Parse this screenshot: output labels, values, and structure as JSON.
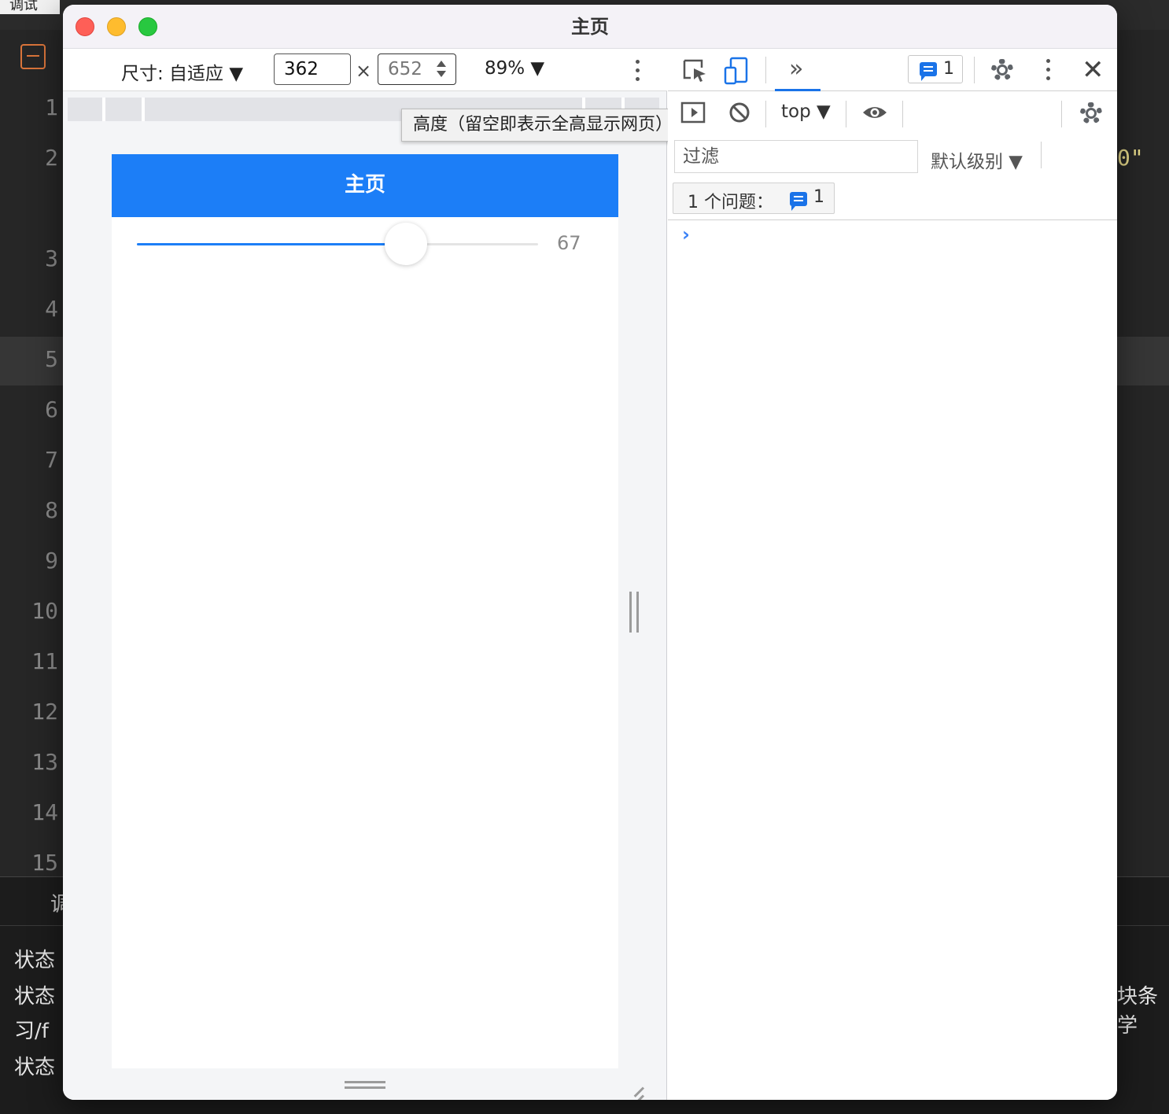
{
  "background_editor": {
    "debug_tab": "调试",
    "line_numbers": [
      "1",
      "2",
      "3",
      "4",
      "5",
      "6",
      "7",
      "8",
      "9",
      "10",
      "11",
      "12",
      "13",
      "14",
      "15"
    ],
    "code_fragment": "0\" ",
    "panel_tab": "调",
    "status_lines": [
      "状态",
      "状态",
      "习/f",
      "状态"
    ],
    "right_text": "块条学"
  },
  "window": {
    "title": "主页"
  },
  "device_toolbar": {
    "dimensions_label": "尺寸: 自适应 ▼",
    "width_value": "362",
    "times_sign": "×",
    "height_value": "652",
    "zoom_label": "89% ▼"
  },
  "tooltip": {
    "text": "高度（留空即表示全高显示网页）"
  },
  "phone": {
    "nav_title": "主页",
    "slider": {
      "value": 67,
      "min": 0,
      "max": 100,
      "value_label": "67"
    },
    "colors": {
      "primary": "#1c7ef7"
    }
  },
  "devtools": {
    "more_tabs": "»",
    "issues_count": "1",
    "context_selector": "top ▼",
    "filter_placeholder": "过滤",
    "level_selector": "默认级别 ▼",
    "issues_label": "1 个问题：",
    "issues_chip_count": "1",
    "prompt": "›",
    "close": "✕"
  }
}
